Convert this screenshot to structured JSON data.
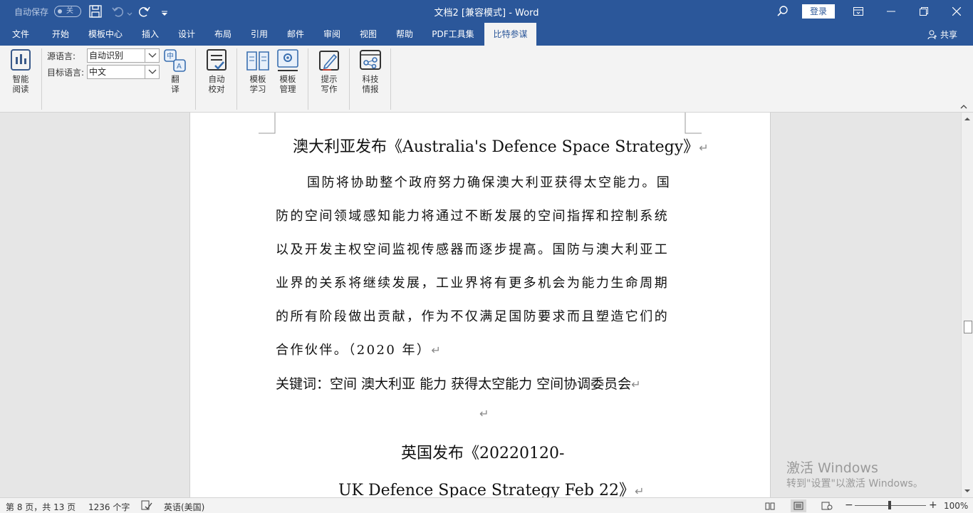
{
  "titlebar": {
    "autosave_label": "自动保存",
    "autosave_toggle": "关",
    "document_title": "文档2 [兼容模式]  -  Word",
    "login_label": "登录",
    "accent_color": "#2b579a"
  },
  "tabs": [
    {
      "label": "文件"
    },
    {
      "label": "开始"
    },
    {
      "label": "模板中心"
    },
    {
      "label": "插入"
    },
    {
      "label": "设计"
    },
    {
      "label": "布局"
    },
    {
      "label": "引用"
    },
    {
      "label": "邮件"
    },
    {
      "label": "审阅"
    },
    {
      "label": "视图"
    },
    {
      "label": "帮助"
    },
    {
      "label": "PDF工具集"
    },
    {
      "label": "比特参谋"
    }
  ],
  "share_label": "共享",
  "ribbon": {
    "smart_read": "智能\n阅读",
    "source_lang_label": "源语言:",
    "source_lang_value": "自动识别",
    "target_lang_label": "目标语言:",
    "target_lang_value": "中文",
    "translate": "翻\n译",
    "auto_proof": "自动\n校对",
    "template_learn": "模板\n学习",
    "template_manage": "模板\n管理",
    "hint_write": "提示\n写作",
    "tech_intel": "科技\n情报"
  },
  "document": {
    "heading1": "澳大利亚发布《Australia's Defence Space Strategy》",
    "body_lines": [
      "国防将协助整个政府努力确保澳大利亚获得太空能力。国",
      "防的空间领域感知能力将通过不断发展的空间指挥和控制系统",
      "以及开发主权空间监视传感器而逐步提高。国防与澳大利亚工",
      "业界的关系将继续发展，工业界将有更多机会为能力生命周期",
      "的所有阶段做出贡献，作为不仅满足国防要求而且塑造它们的",
      "合作伙伴。（2020 年）"
    ],
    "keywords": "关键词：空间 澳大利亚 能力 获得太空能力 空间协调委员会",
    "heading2_line1": "英国发布《20220120-",
    "heading2_line2": "UK  Defence  Space  Strategy  Feb  22》",
    "paragraph_mark": "↵"
  },
  "watermark": {
    "line1": "激活 Windows",
    "line2": "转到\"设置\"以激活 Windows。"
  },
  "statusbar": {
    "page_info": "第 8 页，共 13 页",
    "word_count": "1236 个字",
    "language": "英语(美国)",
    "zoom": "100%",
    "zoom_minus": "−",
    "zoom_plus": "+"
  }
}
